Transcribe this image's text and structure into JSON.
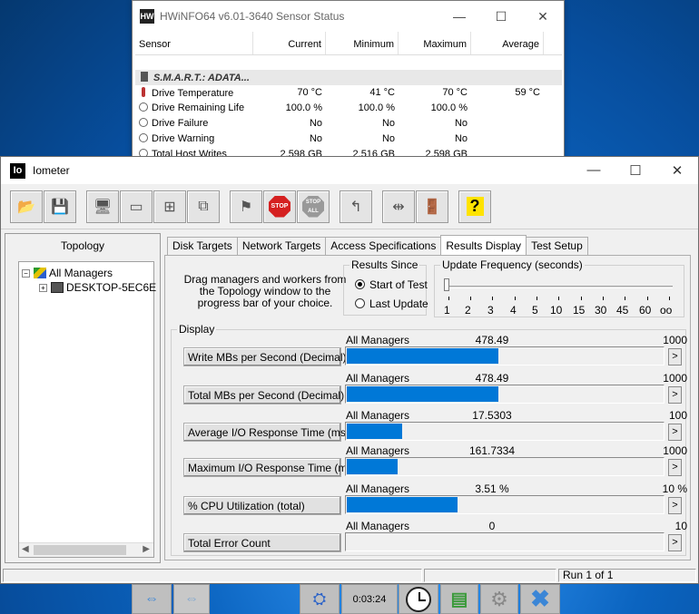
{
  "hwinfo": {
    "title": "HWiNFO64 v6.01-3640 Sensor Status",
    "controls": {
      "minimize": "—",
      "maximize": "☐",
      "close": "✕"
    },
    "headers": [
      "Sensor",
      "Current",
      "Minimum",
      "Maximum",
      "Average"
    ],
    "group": "S.M.A.R.T.: ADATA...",
    "rows": [
      {
        "name": "Drive Temperature",
        "current": "70 °C",
        "minimum": "41 °C",
        "maximum": "70 °C",
        "average": "59 °C",
        "icon": "thermometer-icon"
      },
      {
        "name": "Drive Remaining Life",
        "current": "100.0 %",
        "minimum": "100.0 %",
        "maximum": "100.0 %",
        "average": "",
        "icon": "gauge-icon"
      },
      {
        "name": "Drive Failure",
        "current": "No",
        "minimum": "No",
        "maximum": "No",
        "average": "",
        "icon": "gauge-icon"
      },
      {
        "name": "Drive Warning",
        "current": "No",
        "minimum": "No",
        "maximum": "No",
        "average": "",
        "icon": "gauge-icon"
      },
      {
        "name": "Total Host Writes",
        "current": "2,598 GB",
        "minimum": "2,516 GB",
        "maximum": "2,598 GB",
        "average": "",
        "icon": "gauge-icon"
      }
    ]
  },
  "iometer": {
    "logo": "Io",
    "title": "Iometer",
    "controls": {
      "minimize": "—",
      "maximize": "☐",
      "close": "✕"
    },
    "topology": {
      "title": "Topology",
      "items": [
        {
          "label": "All Managers",
          "expander": "−"
        },
        {
          "label": "DESKTOP-5EC6E",
          "expander": "+"
        }
      ]
    },
    "tabs": [
      {
        "label": "Disk Targets",
        "active": false
      },
      {
        "label": "Network Targets",
        "active": false
      },
      {
        "label": "Access Specifications",
        "active": false
      },
      {
        "label": "Results Display",
        "active": true
      },
      {
        "label": "Test Setup",
        "active": false
      }
    ],
    "drag_note": "Drag managers and workers from the Topology window to the progress bar of your choice.",
    "results_since": {
      "label": "Results Since",
      "options": [
        {
          "label": "Start of Test",
          "selected": true
        },
        {
          "label": "Last Update",
          "selected": false
        }
      ]
    },
    "update_frequency": {
      "label": "Update Frequency (seconds)",
      "ticks": [
        "1",
        "2",
        "3",
        "4",
        "5",
        "10",
        "15",
        "30",
        "45",
        "60",
        "oo"
      ],
      "selected_index": 0
    },
    "display": {
      "label": "Display",
      "rows": [
        {
          "metric": "Write MBs per Second (Decimal)",
          "manager": "All Managers",
          "value": "478.49",
          "max": "1000",
          "fraction": 0.4785
        },
        {
          "metric": "Total MBs per Second (Decimal)",
          "manager": "All Managers",
          "value": "478.49",
          "max": "1000",
          "fraction": 0.4785
        },
        {
          "metric": "Average I/O Response Time (ms)",
          "manager": "All Managers",
          "value": "17.5303",
          "max": "100",
          "fraction": 0.1753
        },
        {
          "metric": "Maximum I/O Response Time (ms)",
          "manager": "All Managers",
          "value": "161.7334",
          "max": "1000",
          "fraction": 0.1617
        },
        {
          "metric": "% CPU Utilization (total)",
          "manager": "All Managers",
          "value": "3.51 %",
          "max": "10 %",
          "fraction": 0.351
        },
        {
          "metric": "Total Error Count",
          "manager": "All Managers",
          "value": "0",
          "max": "10",
          "fraction": 0
        }
      ],
      "arrow": ">"
    },
    "status": {
      "run": "Run 1 of 1"
    }
  },
  "taskbar": {
    "elapsed": "0:03:24"
  }
}
